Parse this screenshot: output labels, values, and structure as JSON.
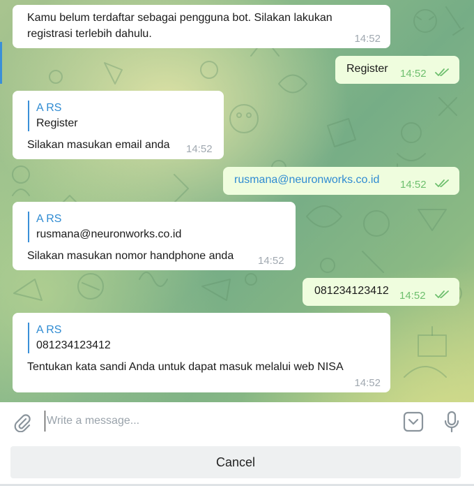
{
  "messages": [
    {
      "direction": "in",
      "text": "Kamu belum terdaftar sebagai pengguna bot. Silakan lakukan",
      "text2": "registrasi terlebih dahulu.",
      "time": "14:52"
    },
    {
      "direction": "out",
      "text": "Register",
      "time": "14:52",
      "status": "read"
    },
    {
      "direction": "in",
      "reply_author": "A RS",
      "reply_text": "Register",
      "text": "Silakan masukan email anda",
      "time": "14:52"
    },
    {
      "direction": "out",
      "text": "rusmana@neuronworks.co.id",
      "time": "14:52",
      "status": "read"
    },
    {
      "direction": "in",
      "reply_author": "A RS",
      "reply_text": "rusmana@neuronworks.co.id",
      "text": "Silakan masukan nomor handphone anda",
      "time": "14:52"
    },
    {
      "direction": "out",
      "text": "081234123412",
      "time": "14:52",
      "status": "read"
    },
    {
      "direction": "in",
      "reply_author": "A RS",
      "reply_text": "081234123412",
      "text": "Tentukan kata sandi Anda untuk dapat masuk melalui web NISA",
      "time": "14:52"
    }
  ],
  "composer": {
    "placeholder": "Write a message...",
    "icons": [
      "paperclip-icon",
      "sticker-icon",
      "microphone-icon"
    ]
  },
  "keyboard": {
    "cancel_label": "Cancel"
  },
  "colors": {
    "accent": "#2f8bd2",
    "outgoing_bubble": "#effdde",
    "read_check": "#6ebf6e"
  }
}
